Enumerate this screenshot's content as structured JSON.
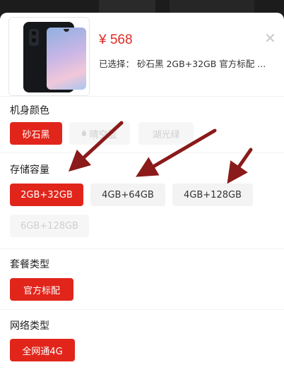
{
  "product": {
    "price": "¥ 568",
    "selected": "已选择： 砂石黑 2GB+32GB 官方标配 ..."
  },
  "sections": {
    "color": {
      "title": "机身颜色",
      "options": [
        "砂石黑",
        "晴空蓝",
        "湖光绿"
      ]
    },
    "storage": {
      "title": "存储容量",
      "options": [
        "2GB+32GB",
        "4GB+64GB",
        "4GB+128GB",
        "6GB+128GB"
      ]
    },
    "package": {
      "title": "套餐类型",
      "options": [
        "官方标配"
      ]
    },
    "network": {
      "title": "网络类型",
      "options": [
        "全网通4G"
      ]
    }
  },
  "colors": {
    "accent": "#e1251b",
    "price": "#e02a25",
    "arrow": "#8b1a1a"
  }
}
